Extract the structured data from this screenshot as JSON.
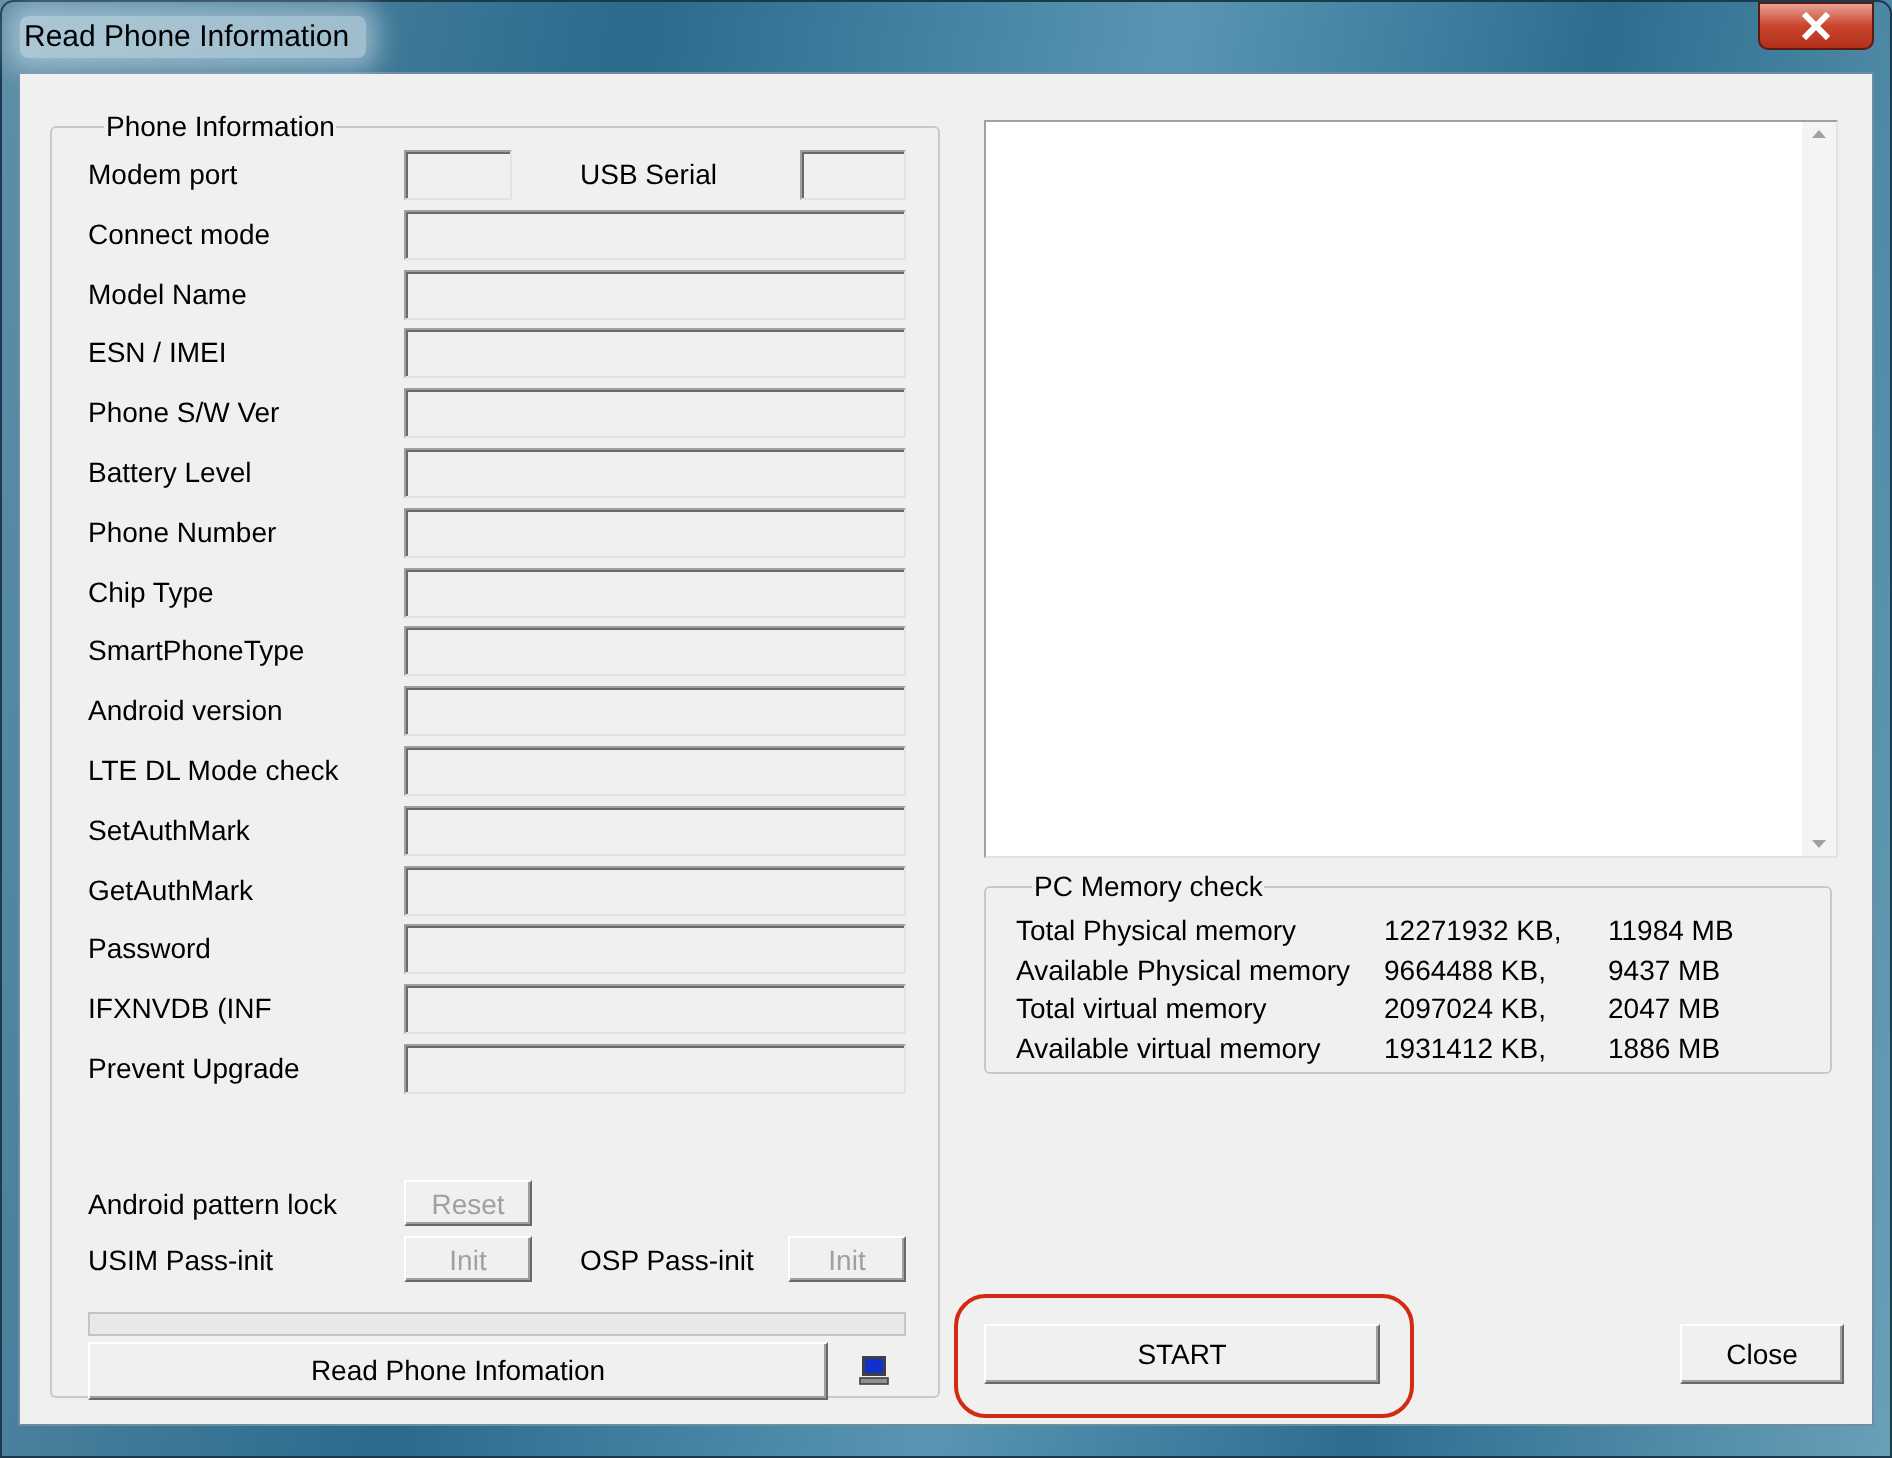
{
  "window": {
    "title": "Read Phone Information"
  },
  "phone_information": {
    "title": "Phone Information",
    "port_row": {
      "modem_port": {
        "label": "Modem port"
      },
      "usb_serial": {
        "label": "USB Serial"
      }
    },
    "fields": [
      {
        "label": "Connect mode"
      },
      {
        "label": "Model Name"
      },
      {
        "label": "ESN / IMEI"
      },
      {
        "label": "Phone S/W Ver"
      },
      {
        "label": "Battery Level"
      },
      {
        "label": "Phone Number"
      },
      {
        "label": "Chip Type"
      },
      {
        "label": "SmartPhoneType"
      },
      {
        "label": "Android version"
      },
      {
        "label": "LTE DL Mode check"
      },
      {
        "label": "SetAuthMark"
      },
      {
        "label": "GetAuthMark"
      },
      {
        "label": "Password"
      },
      {
        "label": "IFXNVDB (INF"
      },
      {
        "label": "Prevent Upgrade"
      }
    ],
    "pattern_lock": {
      "label": "Android pattern lock",
      "button": {
        "label": "Reset",
        "disabled": true
      }
    },
    "usim": {
      "label": "USIM Pass-init",
      "button": {
        "label": "Init",
        "disabled": true
      }
    },
    "osp": {
      "label": "OSP Pass-init",
      "button": {
        "label": "Init",
        "disabled": true
      }
    },
    "progress": {
      "level": 0
    },
    "read_button": {
      "label": "Read Phone Infomation"
    }
  },
  "memory": {
    "title": "PC Memory check",
    "rows": [
      {
        "name": "Total Physical memory",
        "kb": "12271932 KB,",
        "mb": "11984 MB"
      },
      {
        "name": "Available Physical memory",
        "kb": "9664488 KB,",
        "mb": "9437 MB"
      },
      {
        "name": "Total virtual memory",
        "kb": "2097024 KB,",
        "mb": "2047 MB"
      },
      {
        "name": "Available virtual memory",
        "kb": "1931412 KB,",
        "mb": "1886 MB"
      }
    ]
  },
  "start_button": {
    "label": "START",
    "highlighted": true
  },
  "close_button": {
    "label": "Close"
  }
}
